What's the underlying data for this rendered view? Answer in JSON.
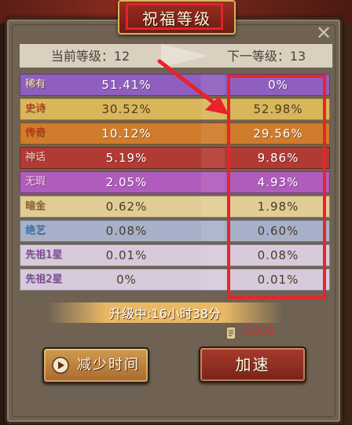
{
  "title": "祝福等级",
  "close_icon": "close-icon",
  "levels": {
    "current_label": "当前等级：12",
    "next_label": "下一等级：13"
  },
  "rows": [
    {
      "name": "稀有",
      "current": "51.41%",
      "next": "0%",
      "bg": "#8f5fbf",
      "name_color": "#ffe9a8"
    },
    {
      "name": "史诗",
      "current": "30.52%",
      "next": "52.98%",
      "bg": "#d8b659",
      "name_color": "#c2301f"
    },
    {
      "name": "传奇",
      "current": "10.12%",
      "next": "29.56%",
      "bg": "#cf7c2c",
      "name_color": "#c2301f"
    },
    {
      "name": "神话",
      "current": "5.19%",
      "next": "9.86%",
      "bg": "#b23a34",
      "name_color": "#ffd1c8"
    },
    {
      "name": "无瑕",
      "current": "2.05%",
      "next": "4.93%",
      "bg": "#b05cbc",
      "name_color": "#ffd1f0"
    },
    {
      "name": "暗金",
      "current": "0.62%",
      "next": "1.98%",
      "bg": "#e2cc95",
      "name_color": "#8a5a1c"
    },
    {
      "name": "绝艺",
      "current": "0.08%",
      "next": "0.60%",
      "bg": "#a6b1c9",
      "name_color": "#2a6fb5"
    },
    {
      "name": "先祖1星",
      "current": "0.01%",
      "next": "0.08%",
      "bg": "#d6cadb",
      "name_color": "#7a3aa0"
    },
    {
      "name": "先祖2星",
      "current": "0%",
      "next": "0.01%",
      "bg": "#d6cadb",
      "name_color": "#7a3aa0"
    }
  ],
  "timer": "升级中:16小时38分",
  "progress": "0/200",
  "buttons": {
    "reduce_time": "减少时间",
    "speed_up": "加速"
  },
  "colors": {
    "annotation_red": "#e8232a",
    "progress_red": "#e0282a"
  }
}
